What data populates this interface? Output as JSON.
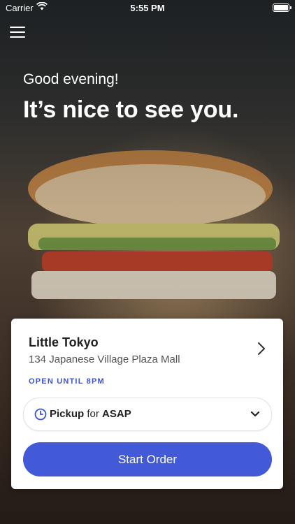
{
  "status_bar": {
    "carrier": "Carrier",
    "time": "5:55 PM"
  },
  "header": {
    "greeting": "Good evening!",
    "headline": "It’s nice to see you."
  },
  "store": {
    "name": "Little Tokyo",
    "address": "134 Japanese Village Plaza Mall",
    "hours_status": "OPEN UNTIL 8PM"
  },
  "order_options": {
    "method": "Pickup",
    "connector": "for",
    "time": "ASAP"
  },
  "actions": {
    "start_order_label": "Start Order"
  },
  "colors": {
    "accent": "#4259d8",
    "status_text": "#3d55c9"
  }
}
